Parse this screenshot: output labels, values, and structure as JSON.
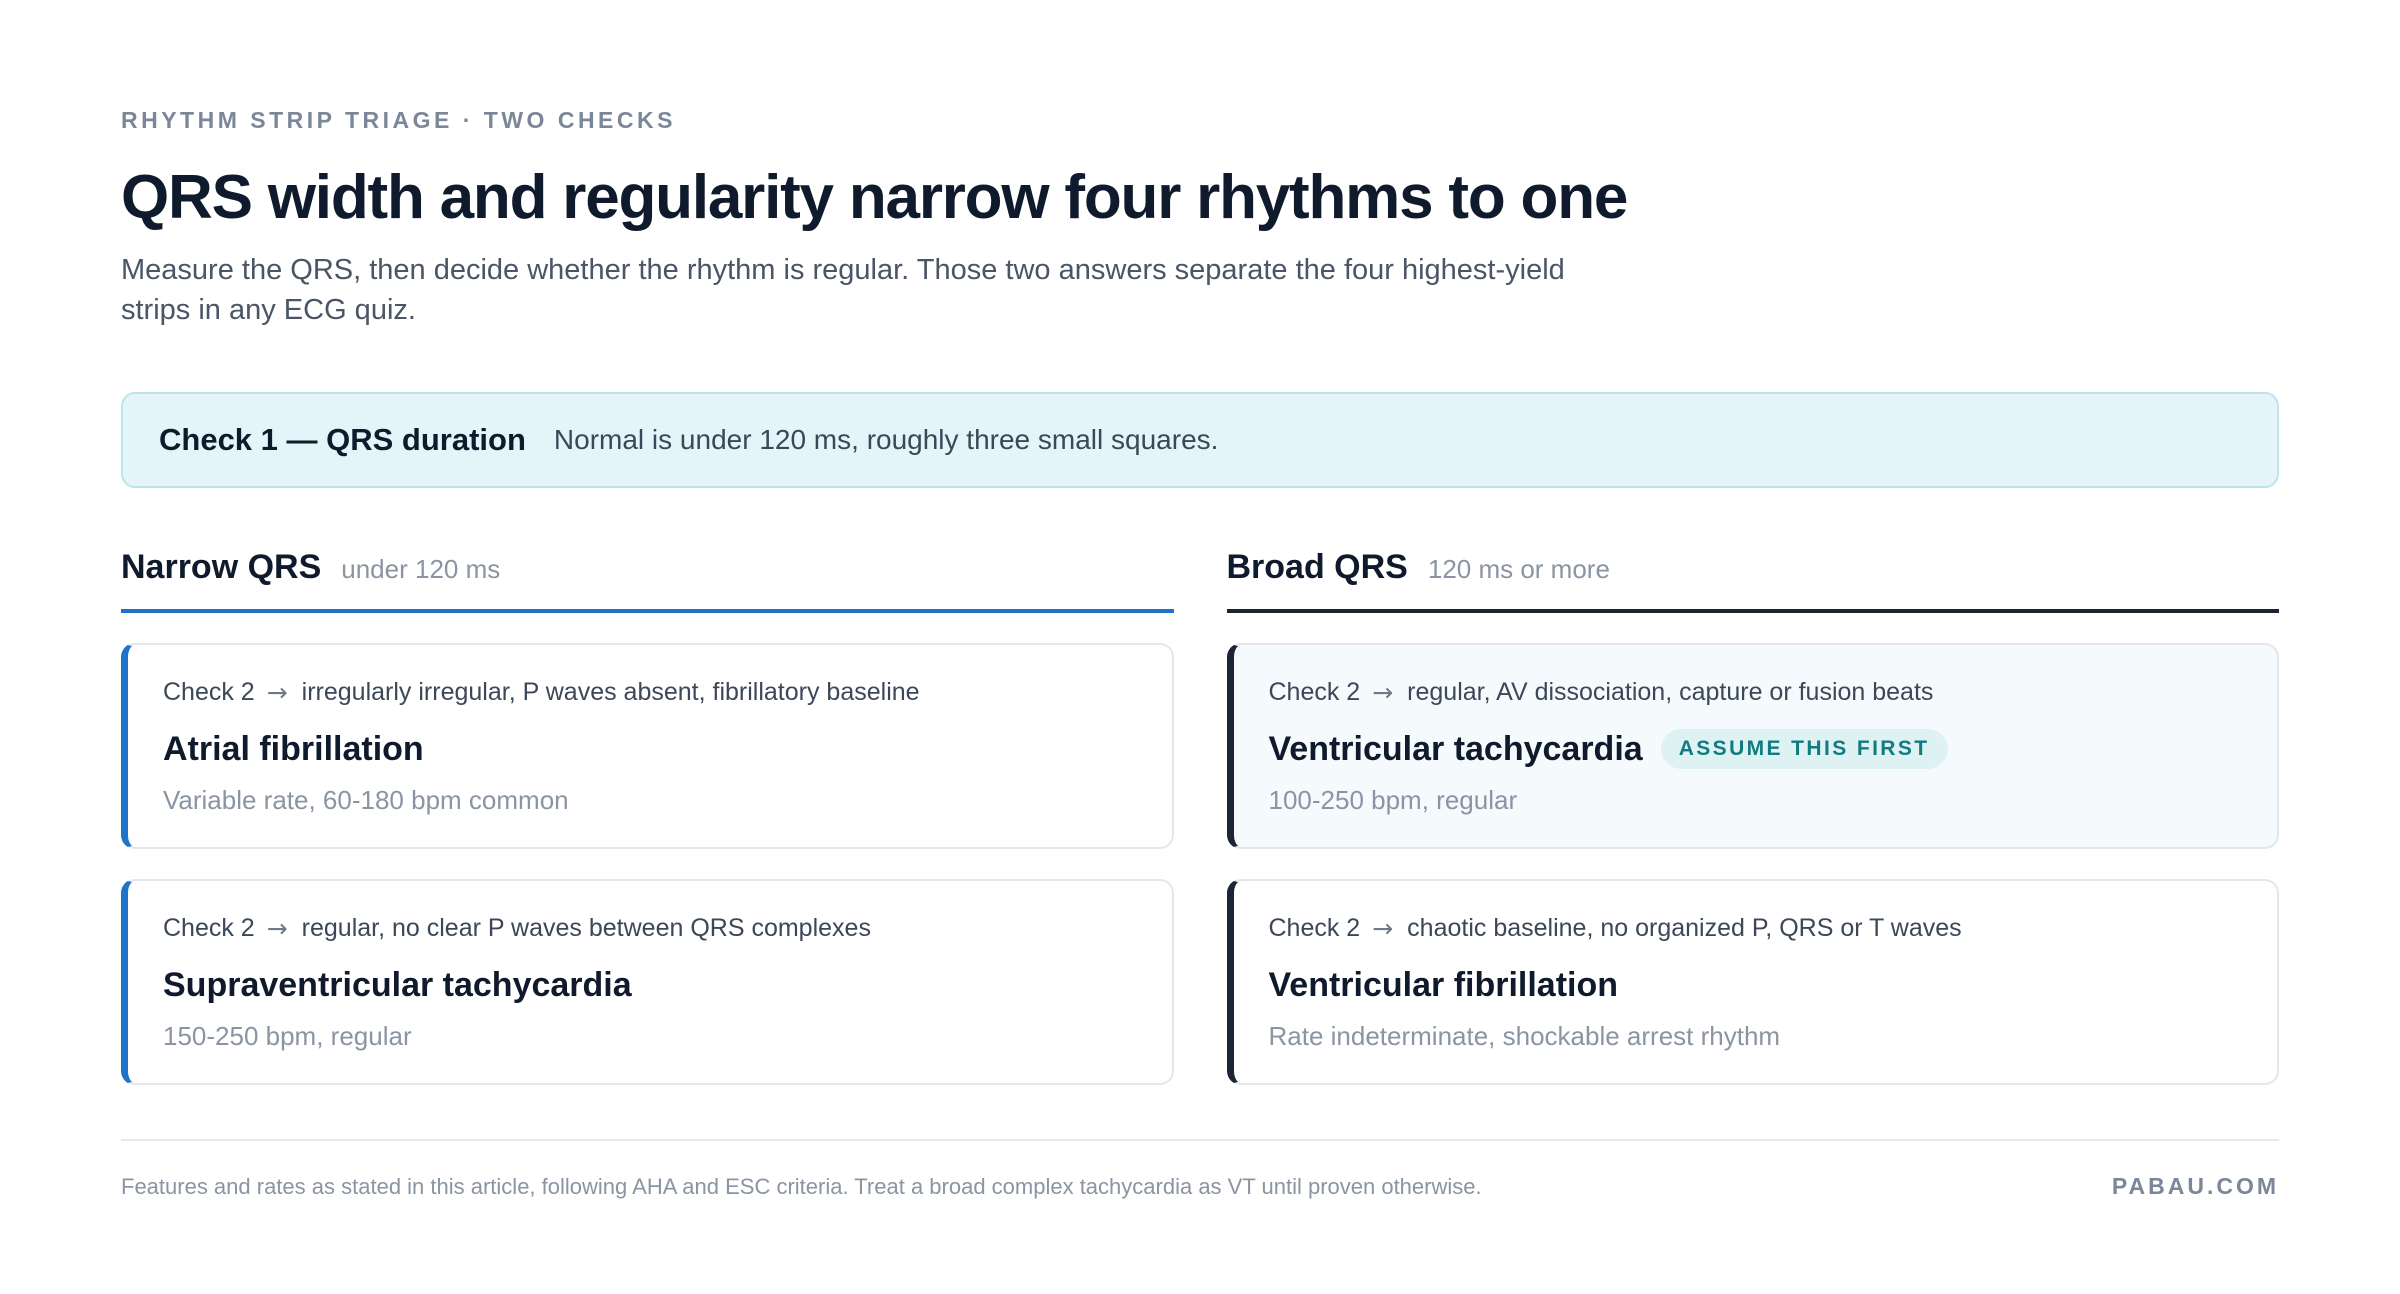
{
  "header": {
    "eyebrow": "RHYTHM STRIP TRIAGE · TWO CHECKS",
    "title": "QRS width and regularity narrow four rhythms to one",
    "subtitle": "Measure the QRS, then decide whether the rhythm is regular. Those two answers separate the four highest-yield strips in any ECG quiz."
  },
  "check1": {
    "label": "Check 1 — QRS duration",
    "text": "Normal is under 120 ms, roughly three small squares."
  },
  "columns": [
    {
      "title": "Narrow QRS",
      "subtitle": "under 120 ms",
      "accent": "#1f74c8",
      "cards": [
        {
          "check": "Check 2",
          "criteria": "irregularly irregular, P waves absent, fibrillatory baseline",
          "title": "Atrial fibrillation",
          "meta": "Variable rate, 60-180 bpm common"
        },
        {
          "check": "Check 2",
          "criteria": "regular, no clear P waves between QRS complexes",
          "title": "Supraventricular tachycardia",
          "meta": "150-250 bpm, regular"
        }
      ]
    },
    {
      "title": "Broad QRS",
      "subtitle": "120 ms or more",
      "accent": "#1b2536",
      "cards": [
        {
          "check": "Check 2",
          "criteria": "regular, AV dissociation, capture or fusion beats",
          "title": "Ventricular tachycardia",
          "badge": "ASSUME THIS FIRST",
          "meta": "100-250 bpm, regular"
        },
        {
          "check": "Check 2",
          "criteria": "chaotic baseline, no organized P, QRS or T waves",
          "title": "Ventricular fibrillation",
          "meta": "Rate indeterminate, shockable arrest rhythm"
        }
      ]
    }
  ],
  "footer": {
    "note": "Features and rates as stated in this article, following AHA and ESC criteria. Treat a broad complex tachycardia as VT until proven otherwise.",
    "brand": "PABAU.COM"
  },
  "icons": {
    "arrow": "arrow-right-icon"
  }
}
